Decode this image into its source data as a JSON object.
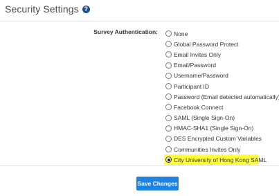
{
  "header": {
    "title": "Security Settings",
    "help_icon_glyph": "?"
  },
  "survey_auth": {
    "label": "Survey Authentication:",
    "selected_index": 11,
    "options": [
      {
        "label": "None",
        "selected": false
      },
      {
        "label": "Global Password Protect",
        "selected": false
      },
      {
        "label": "Email Invites Only",
        "selected": false
      },
      {
        "label": "Email/Password",
        "selected": false
      },
      {
        "label": "Username/Password",
        "selected": false
      },
      {
        "label": "Participant ID",
        "selected": false
      },
      {
        "label": "Password (Email detected automatically)",
        "selected": false
      },
      {
        "label": "Facebook Connect",
        "selected": false
      },
      {
        "label": "SAML (Single Sign-On)",
        "selected": false
      },
      {
        "label": "HMAC-SHA1 (Single Sign-On)",
        "selected": false
      },
      {
        "label": "DES Encrypted Custom Variables",
        "selected": false
      },
      {
        "label": "Communities Invites Only",
        "selected": false
      },
      {
        "label": "City University of Hong Kong SAML",
        "selected": true
      }
    ]
  },
  "actions": {
    "save_label": "Save Changes"
  },
  "colors": {
    "accent": "#1e82e0",
    "help_icon": "#1b4f8f",
    "highlight": "#ffff3a"
  }
}
